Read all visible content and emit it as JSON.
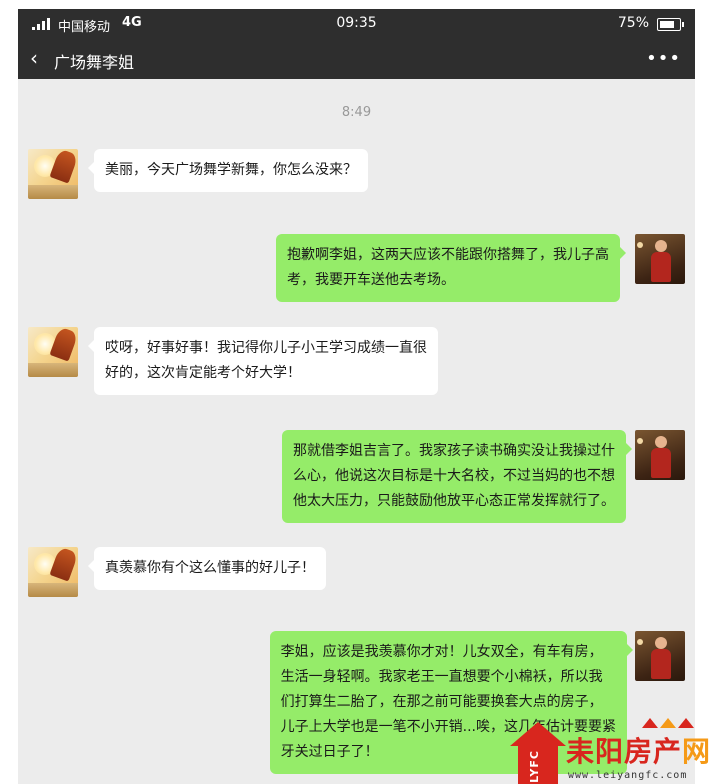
{
  "status_bar": {
    "carrier": "中国移动",
    "network": "4G",
    "time": "09:35",
    "battery": "75%",
    "battery_level": 0.75
  },
  "nav": {
    "title": "广场舞李姐"
  },
  "chat": {
    "timestamp": "8:49",
    "messages": [
      {
        "side": "left",
        "lines": [
          "美丽，今天广场舞学新舞，你怎么没来？"
        ]
      },
      {
        "side": "right",
        "lines": [
          "抱歉啊李姐，这两天应该不能跟你搭舞了，我儿子高",
          "考，我要开车送他去考场。"
        ]
      },
      {
        "side": "left",
        "lines": [
          "哎呀，好事好事！我记得你儿子小王学习成绩一直很",
          "好的，这次肯定能考个好大学！"
        ]
      },
      {
        "side": "right",
        "lines": [
          "那就借李姐吉言了。我家孩子读书确实没让我操过什",
          "么心，他说这次目标是十大名校，不过当妈的也不想",
          "他太大压力，只能鼓励他放平心态正常发挥就行了。"
        ]
      },
      {
        "side": "left",
        "lines": [
          "真羡慕你有个这么懂事的好儿子！"
        ]
      },
      {
        "side": "right",
        "lines": [
          "李姐，应该是我羡慕你才对！儿女双全，有车有房，",
          "生活一身轻啊。我家老王一直想要个小棉袄，所以我",
          "们打算生二胎了，在那之前可能要换套大点的房子，",
          "儿子上大学也是一笔不小开销...唉，这几年估计要要紧",
          "牙关过日子了！"
        ]
      }
    ]
  },
  "watermark": {
    "badge": "LYFC",
    "name_part1": "耒阳房产",
    "name_part2": "网",
    "url": "www.leiyangfc.com"
  },
  "icons": {
    "signal": "signal-bars-icon",
    "battery": "battery-icon",
    "back": "chevron-left-icon",
    "more": "more-dots-icon"
  },
  "colors": {
    "bar_bg": "#2e2e2e",
    "chat_bg": "#ececec",
    "bubble_mine": "#95ec69",
    "bubble_theirs": "#ffffff",
    "watermark_red": "#d8261e",
    "watermark_orange": "#f59a17"
  }
}
